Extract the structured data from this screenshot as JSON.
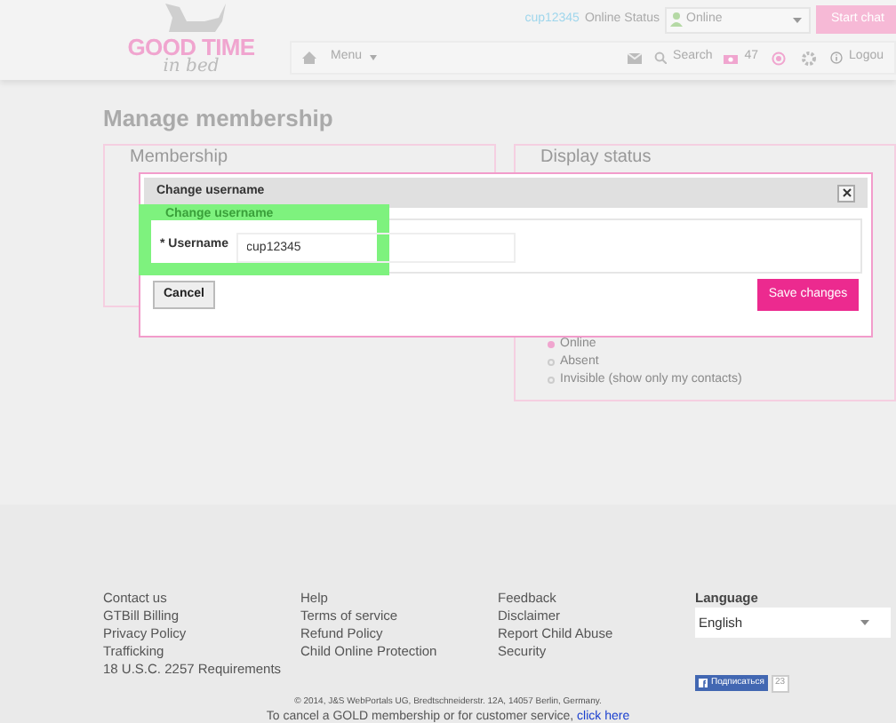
{
  "header": {
    "logo": {
      "line1": "GOOD TIME",
      "line2": "in bed"
    },
    "username": "cup12345",
    "online_status_label": "Online Status",
    "status_select": {
      "value": "Online"
    },
    "start_chat_button": "Start chat"
  },
  "nav": {
    "menu": "Menu",
    "search": "Search",
    "photo_count": "47",
    "logout": "Logou"
  },
  "page_title": "Manage membership",
  "cards": [
    {
      "title": "Membership"
    },
    {
      "title": "Display status",
      "options": [
        {
          "label": "Online",
          "selected": true
        },
        {
          "label": "Absent",
          "selected": false
        },
        {
          "label": "Invisible (show only my contacts)",
          "selected": false
        }
      ]
    }
  ],
  "dialog": {
    "title": "Change username",
    "legend": "Change username",
    "field_label": "* Username",
    "field_value": "cup12345",
    "cancel_button": "Cancel",
    "save_button": "Save changes"
  },
  "footer": {
    "columns": [
      [
        "Contact us",
        "GTBill Billing",
        "Privacy Policy",
        "Trafficking",
        "18 U.S.C. 2257 Requirements"
      ],
      [
        "Help",
        "Terms of service",
        "Refund Policy",
        "Child Online Protection"
      ],
      [
        "Feedback",
        "Disclaimer",
        "Report Child Abuse",
        "Security"
      ]
    ],
    "language_label": "Language",
    "language_select": "English",
    "like_button": "Подписаться",
    "like_count": "23",
    "copyright": "© 2014, J&S WebPortals UG, Bredtschneiderstr. 12A, 14057 Berlin, Germany.",
    "cancel_text": "To cancel a GOLD membership or for customer service,",
    "cancel_link": "click here"
  }
}
